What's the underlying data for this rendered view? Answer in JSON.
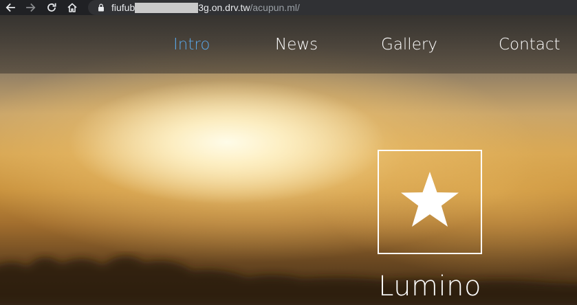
{
  "browser": {
    "url_prefix": "fiufub",
    "url_host_suffix": "3g.on.drv.tw",
    "url_path": "/acupun.ml/"
  },
  "nav": {
    "items": [
      {
        "label": "Intro",
        "active": true
      },
      {
        "label": "News",
        "active": false
      },
      {
        "label": "Gallery",
        "active": false
      },
      {
        "label": "Contact",
        "active": false
      }
    ]
  },
  "hero": {
    "icon": "star-icon",
    "title": "Lumino"
  },
  "colors": {
    "active_nav": "#5aa6e6",
    "nav_text": "#ffffff",
    "chrome_bg": "#202124",
    "omnibox_bg": "#303134"
  }
}
